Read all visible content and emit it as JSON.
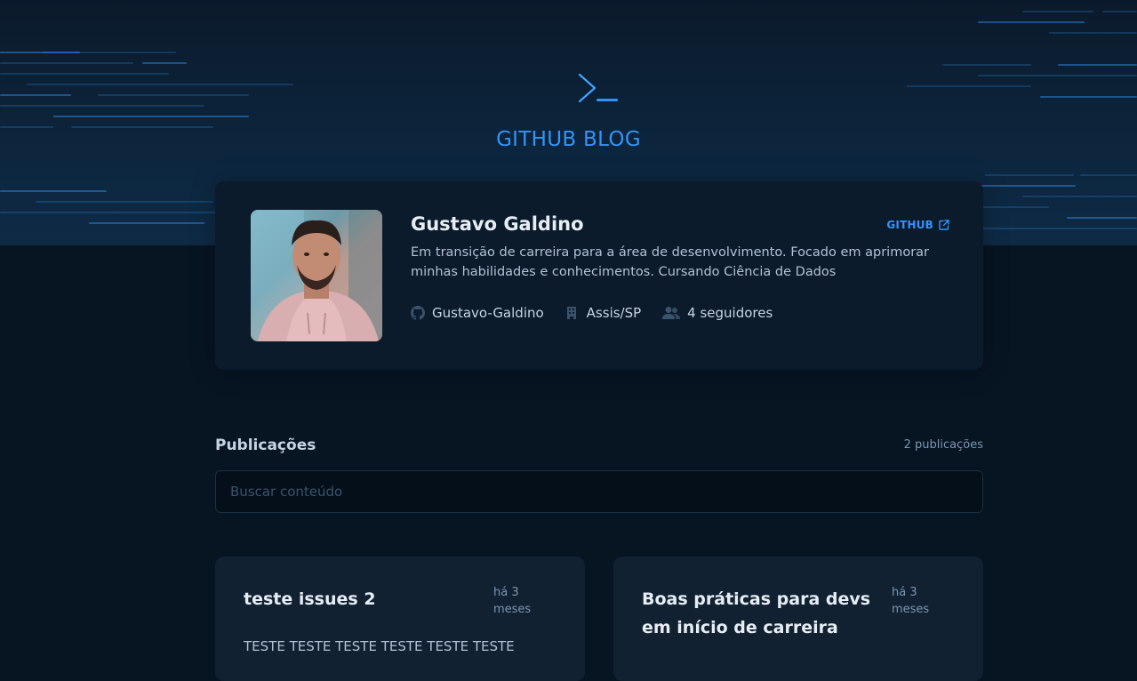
{
  "header": {
    "brand": "GITHUB BLOG",
    "logo_icon": "terminal-prompt-icon",
    "accent": "#3294F8"
  },
  "profile": {
    "name": "Gustavo Galdino",
    "github_link_label": "GITHUB",
    "bio": "Em transição de carreira para a área de desenvolvimento. Focado em aprimorar minhas habilidades e conhecimentos. Cursando Ciência de Dados",
    "username": "Gustavo-Galdino",
    "location": "Assis/SP",
    "followers": "4 seguidores",
    "icons": [
      "github-icon",
      "building-icon",
      "users-icon",
      "external-link-icon"
    ]
  },
  "publications": {
    "title": "Publicações",
    "count": "2 publicações",
    "search_placeholder": "Buscar conteúdo",
    "search_value": "",
    "posts": [
      {
        "title": "teste issues 2",
        "date": "há 3 meses",
        "excerpt": "TESTE TESTE TESTE TESTE TESTE TESTE"
      },
      {
        "title": "Boas práticas para devs em início de carreira",
        "date": "há 3 meses",
        "excerpt": ""
      }
    ]
  },
  "colors": {
    "background": "#071422",
    "profile_card": "#0B1B2B",
    "post_card": "#112131",
    "title_text": "#E7EDF4",
    "body_text": "#AFC2D4",
    "muted_text": "#7B96B2"
  }
}
